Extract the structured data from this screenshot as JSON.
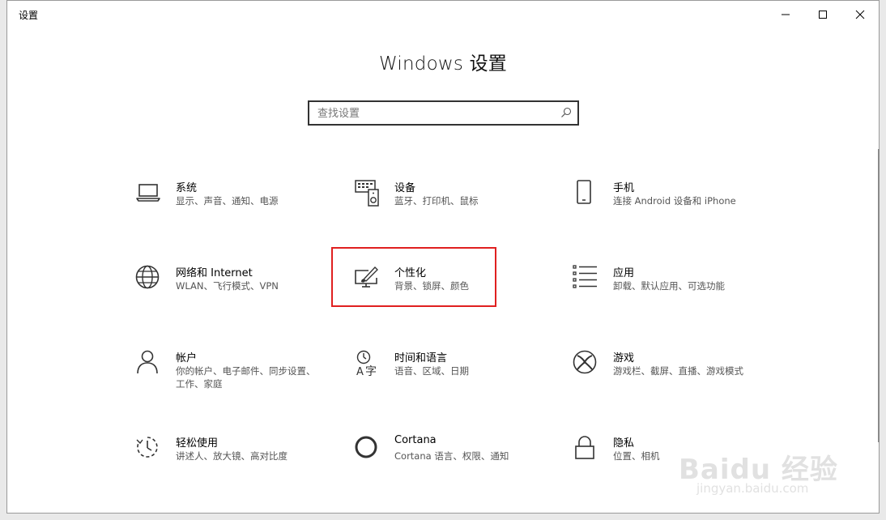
{
  "window": {
    "title": "设置"
  },
  "header": {
    "title": "Windows 设置"
  },
  "search": {
    "placeholder": "查找设置"
  },
  "tiles": [
    {
      "name": "系统",
      "desc": "显示、声音、通知、电源",
      "icon": "laptop-icon"
    },
    {
      "name": "设备",
      "desc": "蓝牙、打印机、鼠标",
      "icon": "devices-icon"
    },
    {
      "name": "手机",
      "desc": "连接 Android 设备和 iPhone",
      "icon": "phone-icon"
    },
    {
      "name": "网络和 Internet",
      "desc": "WLAN、飞行模式、VPN",
      "icon": "globe-icon"
    },
    {
      "name": "个性化",
      "desc": "背景、锁屏、颜色",
      "icon": "personalization-icon"
    },
    {
      "name": "应用",
      "desc": "卸载、默认应用、可选功能",
      "icon": "apps-list-icon"
    },
    {
      "name": "帐户",
      "desc": "你的帐户、电子邮件、同步设置、工作、家庭",
      "icon": "person-icon"
    },
    {
      "name": "时间和语言",
      "desc": "语音、区域、日期",
      "icon": "time-language-icon"
    },
    {
      "name": "游戏",
      "desc": "游戏栏、截屏、直播、游戏模式",
      "icon": "xbox-icon"
    },
    {
      "name": "轻松使用",
      "desc": "讲述人、放大镜、高对比度",
      "icon": "ease-of-access-icon"
    },
    {
      "name": "Cortana",
      "desc": "Cortana 语言、权限、通知",
      "icon": "cortana-icon"
    },
    {
      "name": "隐私",
      "desc": "位置、相机",
      "icon": "lock-icon"
    }
  ],
  "watermark": {
    "main": "Baidu 经验",
    "sub": "jingyan.baidu.com"
  },
  "colors": {
    "highlight": "#e02020",
    "icon": "#333333"
  }
}
